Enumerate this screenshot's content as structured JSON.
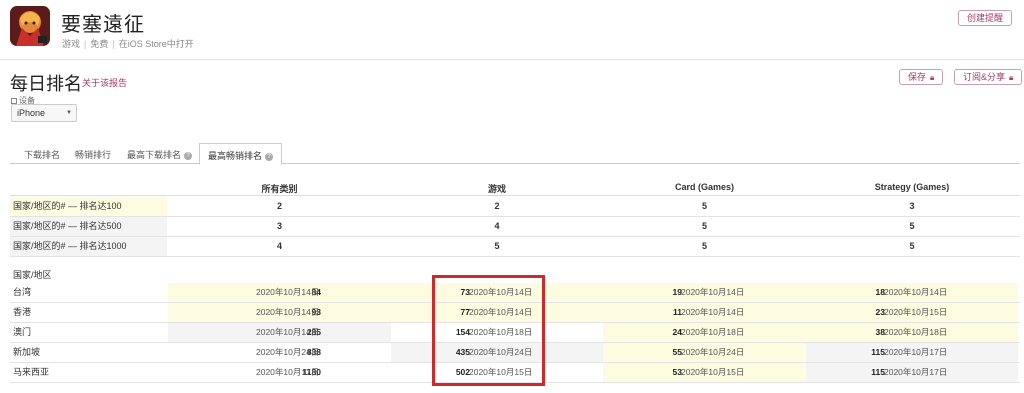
{
  "app": {
    "name": "要塞遠征",
    "category": "游戏",
    "price": "免费",
    "store_link": "在iOS Store中打开",
    "create_alert_label": "创建提醒"
  },
  "page": {
    "title": "每日排名",
    "about_link": "关于该报告",
    "save_label": "保存",
    "subscribe_label": "订阅&分享"
  },
  "device": {
    "label": "设备",
    "selected": "iPhone"
  },
  "tabs": [
    {
      "label": "下载排名"
    },
    {
      "label": "畅销排行"
    },
    {
      "label": "最高下载排名"
    },
    {
      "label": "最高畅销排名"
    }
  ],
  "table": {
    "columns": [
      "所有类别",
      "游戏",
      "Card (Games)",
      "Strategy (Games)"
    ],
    "summary_rows": [
      {
        "label": "国家/地区的# — 排名达100",
        "values": [
          "2",
          "2",
          "5",
          "3"
        ]
      },
      {
        "label": "国家/地区的# — 排名达500",
        "values": [
          "3",
          "4",
          "5",
          "5"
        ]
      },
      {
        "label": "国家/地区的# — 排名达1000",
        "values": [
          "4",
          "5",
          "5",
          "5"
        ]
      }
    ],
    "country_section_title": "国家/地区",
    "country_rows": [
      {
        "label": "台湾",
        "cells": [
          {
            "rank": "84",
            "date": "2020年10月14日"
          },
          {
            "rank": "73",
            "date": "2020年10月14日"
          },
          {
            "rank": "19",
            "date": "2020年10月14日"
          },
          {
            "rank": "18",
            "date": "2020年10月14日"
          }
        ]
      },
      {
        "label": "香港",
        "cells": [
          {
            "rank": "93",
            "date": "2020年10月14日"
          },
          {
            "rank": "77",
            "date": "2020年10月14日"
          },
          {
            "rank": "11",
            "date": "2020年10月14日"
          },
          {
            "rank": "23",
            "date": "2020年10月15日"
          }
        ]
      },
      {
        "label": "澳门",
        "cells": [
          {
            "rank": "285",
            "date": "2020年10月14日"
          },
          {
            "rank": "154",
            "date": "2020年10月18日"
          },
          {
            "rank": "24",
            "date": "2020年10月18日"
          },
          {
            "rank": "38",
            "date": "2020年10月18日"
          }
        ]
      },
      {
        "label": "新加坡",
        "cells": [
          {
            "rank": "838",
            "date": "2020年10月24日"
          },
          {
            "rank": "435",
            "date": "2020年10月24日"
          },
          {
            "rank": "55",
            "date": "2020年10月24日"
          },
          {
            "rank": "115",
            "date": "2020年10月17日"
          }
        ]
      },
      {
        "label": "马来西亚",
        "cells": [
          {
            "rank": "1180",
            "date": "2020年10月17日"
          },
          {
            "rank": "502",
            "date": "2020年10月15日"
          },
          {
            "rank": "53",
            "date": "2020年10月15日"
          },
          {
            "rank": "115",
            "date": "2020年10月17日"
          }
        ]
      }
    ]
  },
  "colors": {
    "accent": "#a23c67",
    "highlight_row": "#fdfce0",
    "annotation_box": "#cc2b2b"
  }
}
